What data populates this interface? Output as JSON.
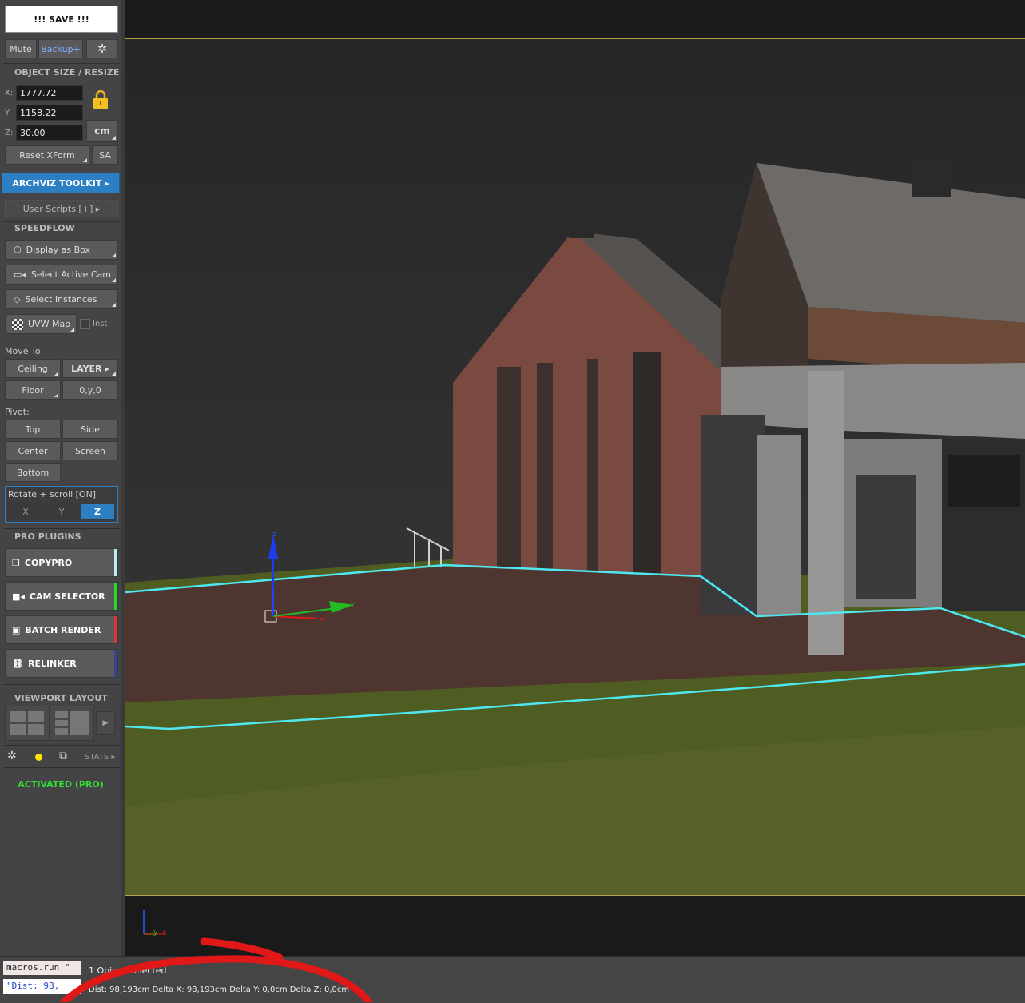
{
  "panel": {
    "save_label": "!!! SAVE !!!",
    "mute_label": "Mute",
    "backup_label": "Backup+",
    "object_size_heading": "OBJECT SIZE / RESIZE",
    "x_label": "X:",
    "x_value": "1777.72",
    "y_label": "Y:",
    "y_value": "1158.22",
    "z_label": "Z:",
    "z_value": "30.00",
    "unit_label": "cm",
    "reset_xform_label": "Reset XForm",
    "sa_label": "SA",
    "archviz_label": "ARCHVIZ TOOLKIT ▸",
    "user_scripts_label": "User Scripts [+] ▸",
    "speedflow_heading": "SPEEDFLOW",
    "display_box_label": "Display as Box",
    "select_cam_label": "Select Active Cam",
    "select_instances_label": "Select Instances",
    "uvw_map_label": "UVW Map",
    "inst_label": "Inst",
    "move_to_label": "Move To:",
    "ceiling_label": "Ceiling",
    "layer_label": "LAYER ▸",
    "floor_label": "Floor",
    "origin_label": "0,y,0",
    "pivot_label": "Pivot:",
    "top_label": "Top",
    "side_label": "Side",
    "center_label": "Center",
    "screen_label": "Screen",
    "bottom_label": "Bottom",
    "rotate_scroll_label": "Rotate + scroll  [ON]",
    "axis_x": "X",
    "axis_y": "Y",
    "axis_z": "Z",
    "pro_plugins_heading": "PRO PLUGINS",
    "plugins": [
      {
        "label": "COPYPRO",
        "color": "#b8f0f0"
      },
      {
        "label": "CAM SELECTOR",
        "color": "#22dd22"
      },
      {
        "label": "BATCH RENDER",
        "color": "#dd3333"
      },
      {
        "label": "RELINKER",
        "color": "#334499"
      }
    ],
    "viewport_layout_heading": "VIEWPORT LAYOUT",
    "stats_label": "STATS ▸",
    "activated_label": "ACTIVATED (PRO)"
  },
  "viewport": {
    "gizmo_x": "x",
    "gizmo_y": "y",
    "gizmo_z": "z",
    "corner_y": "y",
    "corner_x": "x"
  },
  "status": {
    "macro_field": "macros.run \"",
    "dist_field": "\"Dist: 98,",
    "selection_text": "1 Object Selected",
    "measure_text": "Dist: 98,193cm Delta X: 98,193cm Delta Y: 0,0cm Delta Z: 0,0cm"
  },
  "colors": {
    "accent_blue": "#2d7fc4",
    "activated_green": "#33dd33",
    "selection_cyan": "#4ee8f0",
    "annotation_red": "#e01818"
  }
}
